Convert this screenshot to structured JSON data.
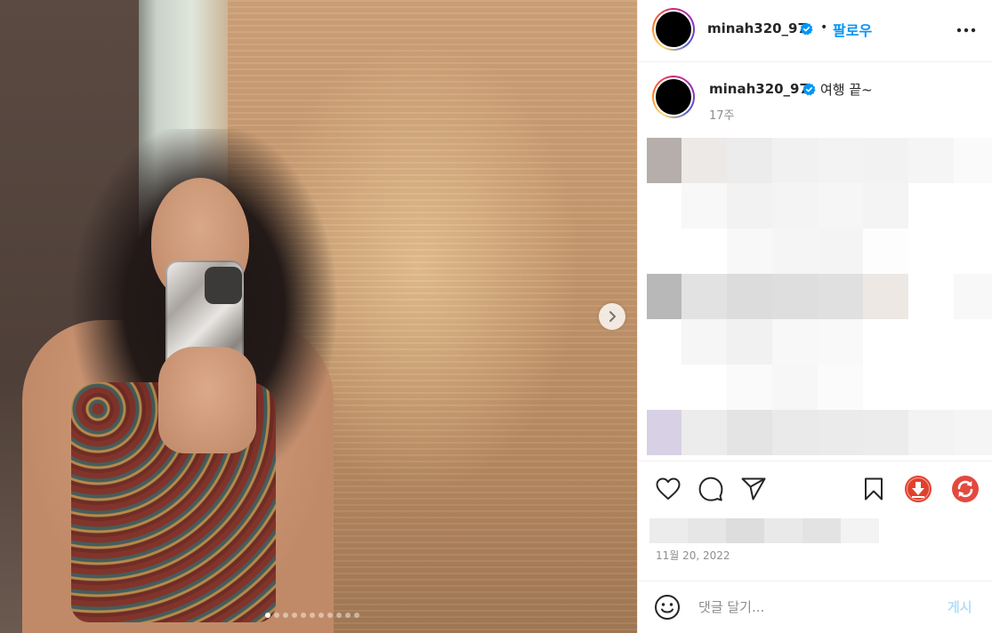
{
  "post": {
    "username": "minah320_97",
    "follow_separator": "•",
    "follow_label": "팔로우",
    "caption": "여행 끝~",
    "posted_ago": "17주",
    "date": "11월 20, 2022",
    "carousel": {
      "total_slides": 11,
      "active_index": 0
    }
  },
  "comment": {
    "placeholder": "댓글 달기...",
    "post_label": "게시"
  },
  "icons": {
    "more": "more-horizontal-icon",
    "verified": "verified-badge-icon",
    "like": "heart-icon",
    "comment": "comment-icon",
    "share": "paper-plane-icon",
    "save": "bookmark-icon",
    "download": "download-icon",
    "refresh": "refresh-icon",
    "emoji": "emoji-smile-icon",
    "next": "chevron-right-icon"
  },
  "colors": {
    "link_blue": "#0095f6",
    "post_disabled": "#b2dffc",
    "download_red": "#e0412e",
    "refresh_red": "#e3493f"
  }
}
